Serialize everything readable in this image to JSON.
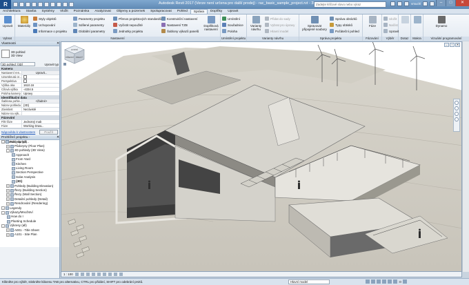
{
  "window": {
    "app_logo": "R",
    "title": "Autodesk Revit 2017 (Verze není určena pro další prodej)  -  rac_basic_sample_project.rvt - 3D pohled: {3D}",
    "search_placeholder": "Zadejte klíčové slovo nebo výraz",
    "user": "vmuchl",
    "colors": {
      "titlebar": "#6a93bd",
      "accent": "#1d4f8c",
      "close": "#c7473a"
    }
  },
  "tabs": [
    "Architektura",
    "Stavba",
    "Systémy",
    "Vložit",
    "Poznámka",
    "Analyzovat",
    "Objemy a pozemek",
    "Spolupracovat",
    "Pohled",
    "Správa",
    "Doplňky",
    "Upravit"
  ],
  "active_tab": "Správa",
  "ribbon": {
    "vybrat": {
      "title": "Vybrat",
      "button": "Upravit"
    },
    "nastaveni": {
      "title": "Nastavení",
      "materialy": "Materiály",
      "col1": [
        "Styly objektů",
        "Uchopování",
        "Informace o projektu"
      ],
      "col2": [
        "Parametry projektu",
        "Sdílené parametry",
        "Globální parametry"
      ],
      "col3": [
        "Přenos projektových standardů",
        "Vyčistit nepoužité",
        "Jednotky projektu"
      ],
      "col4": [
        "Konstrukční nastavení",
        "Nastavení TZB",
        "Šablony výkazů panelů"
      ],
      "doplnkova": "Doplňková nastavení"
    },
    "umisteni": {
      "title": "Umístění projektu",
      "items": [
        "Umístění",
        "Souřadnice",
        "Poloha"
      ]
    },
    "varianty": {
      "title": "Varianty návrhu",
      "button": "Varianty návrhu",
      "items": [
        "Přidat do sady",
        "Vybrat pro úpravy",
        "Hlavní model"
      ]
    },
    "sprava_projektu": {
      "title": "Správa projektu",
      "button": "Spravovat připojené soubory",
      "items": [
        "Správa obrázků",
        "Typy obtisků",
        "Počáteční pohled"
      ]
    },
    "faze": {
      "title": "Fázování",
      "button": "Fáze"
    },
    "vyber": {
      "title": "Výběr",
      "items": [
        "Uložit",
        "Načíst",
        "Upravit"
      ]
    },
    "dotaz": {
      "title": "Dotaz"
    },
    "makra": {
      "title": "Makra"
    },
    "vizualni": {
      "title": "Vizuální programování",
      "button": "Dynamo"
    }
  },
  "properties": {
    "pane_title": "Vlastnosti",
    "type_line1": "3D pohled",
    "type_line2": "3D View",
    "selector": "3D pohled: {3D}",
    "edit_type": "Upravit typ",
    "groups": [
      {
        "name": "Kamera",
        "rows": [
          {
            "k": "Nastavení ren...",
            "v": "Upravit...",
            "btn": true
          },
          {
            "k": "Uzamknutá or...",
            "v": "",
            "check": true
          },
          {
            "k": "Perspektiva",
            "v": "",
            "check": true
          },
          {
            "k": "Výška oka",
            "v": "1610.16"
          },
          {
            "k": "Cílová výška",
            "v": "-4334.5"
          },
          {
            "k": "Poloha kamery",
            "v": "Upravy"
          }
        ]
      },
      {
        "name": "Identifikační data",
        "rows": [
          {
            "k": "Šablona pohle...",
            "v": "<Žádné>",
            "btn": true
          },
          {
            "k": "Název pohledu",
            "v": "{3D}"
          },
          {
            "k": "Závislost",
            "v": "Nezávislé"
          },
          {
            "k": "Název na výk...",
            "v": ""
          }
        ]
      },
      {
        "name": "Fázování",
        "rows": [
          {
            "k": "Filtr fáze",
            "v": "Jednotný mab"
          },
          {
            "k": "Fáze",
            "v": "Working Draw..."
          }
        ]
      }
    ],
    "help_link": "Nápověda k vlastnostem",
    "apply": "Použít"
  },
  "browser": {
    "pane_title": "Prohlížeč projektu - rac_basic_sampl...",
    "nodes": [
      {
        "label": "Pohledy (all)",
        "level": 0,
        "toggle": "-"
      },
      {
        "label": "Půdorysy (Floor Plan)",
        "level": 1,
        "toggle": "+"
      },
      {
        "label": "3D pohledy (3D View)",
        "level": 1,
        "toggle": "-"
      },
      {
        "label": "Approach",
        "level": 2
      },
      {
        "label": "From Yard",
        "level": 2
      },
      {
        "label": "Kitchen",
        "level": 2
      },
      {
        "label": "Living Room",
        "level": 2
      },
      {
        "label": "Section Perspective",
        "level": 2
      },
      {
        "label": "Solar Analysis",
        "level": 2
      },
      {
        "label": "{3D}",
        "level": 2,
        "bold": true
      },
      {
        "label": "Pohledy (Building Elevation)",
        "level": 1,
        "toggle": "+"
      },
      {
        "label": "Řezy (Building Section)",
        "level": 1,
        "toggle": "+"
      },
      {
        "label": "Řezy (Wall Section)",
        "level": 1,
        "toggle": "+"
      },
      {
        "label": "Detailní pohledy (Detail)",
        "level": 1,
        "toggle": "+"
      },
      {
        "label": "Rendrování (Rendering)",
        "level": 1,
        "toggle": "+"
      },
      {
        "label": "Legendy",
        "level": 0,
        "toggle": "-"
      },
      {
        "label": "Výkazy/Množství",
        "level": 0,
        "toggle": "-"
      },
      {
        "label": "How do I",
        "level": 1
      },
      {
        "label": "Planting Schedule",
        "level": 1
      },
      {
        "label": "Výkresy (all)",
        "level": 0,
        "toggle": "-"
      },
      {
        "label": "A001 - Title Sheet",
        "level": 1,
        "toggle": "+"
      },
      {
        "label": "A101 - Site Plan",
        "level": 1,
        "toggle": "+"
      }
    ]
  },
  "viewport": {
    "scale": "1 : 100",
    "viewcube_labels": {
      "top": "HORNÍ",
      "front": "PŘEDNÍ",
      "right": "PRAVÝ"
    }
  },
  "statusbar": {
    "hint": "Klikněte pro výběr, stiskněte klávesu TAB pro alternativu, CTRL pro přidání, SHIFT pro odebrání prvků.",
    "model": "Hlavní model",
    "filter_count": ":0"
  }
}
